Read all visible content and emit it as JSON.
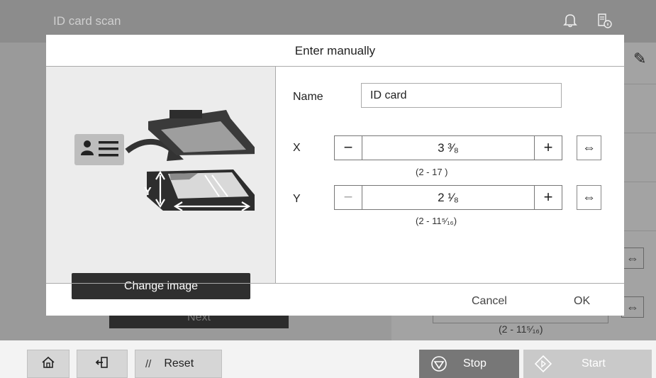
{
  "topbar": {
    "title": "ID card scan"
  },
  "background": {
    "next_label": "Next",
    "range_text": "(2    -  11⁵⁄₁₆)",
    "swap_symbol": "⇔"
  },
  "bottombar": {
    "reset_label": "Reset",
    "stop_label": "Stop",
    "start_label": "Start"
  },
  "modal": {
    "title": "Enter manually",
    "change_image_label": "Change image",
    "name": {
      "label": "Name",
      "value": "ID card"
    },
    "x": {
      "label": "X",
      "value": "3 ³⁄₈",
      "range": "(2    -  17    )",
      "minus": "−",
      "plus": "+"
    },
    "y": {
      "label": "Y",
      "value": "2 ¹⁄₈",
      "range": "(2    -  11⁵⁄₁₆)",
      "minus": "−",
      "plus": "+"
    },
    "swap_symbol": "⇔",
    "cancel_label": "Cancel",
    "ok_label": "OK"
  }
}
